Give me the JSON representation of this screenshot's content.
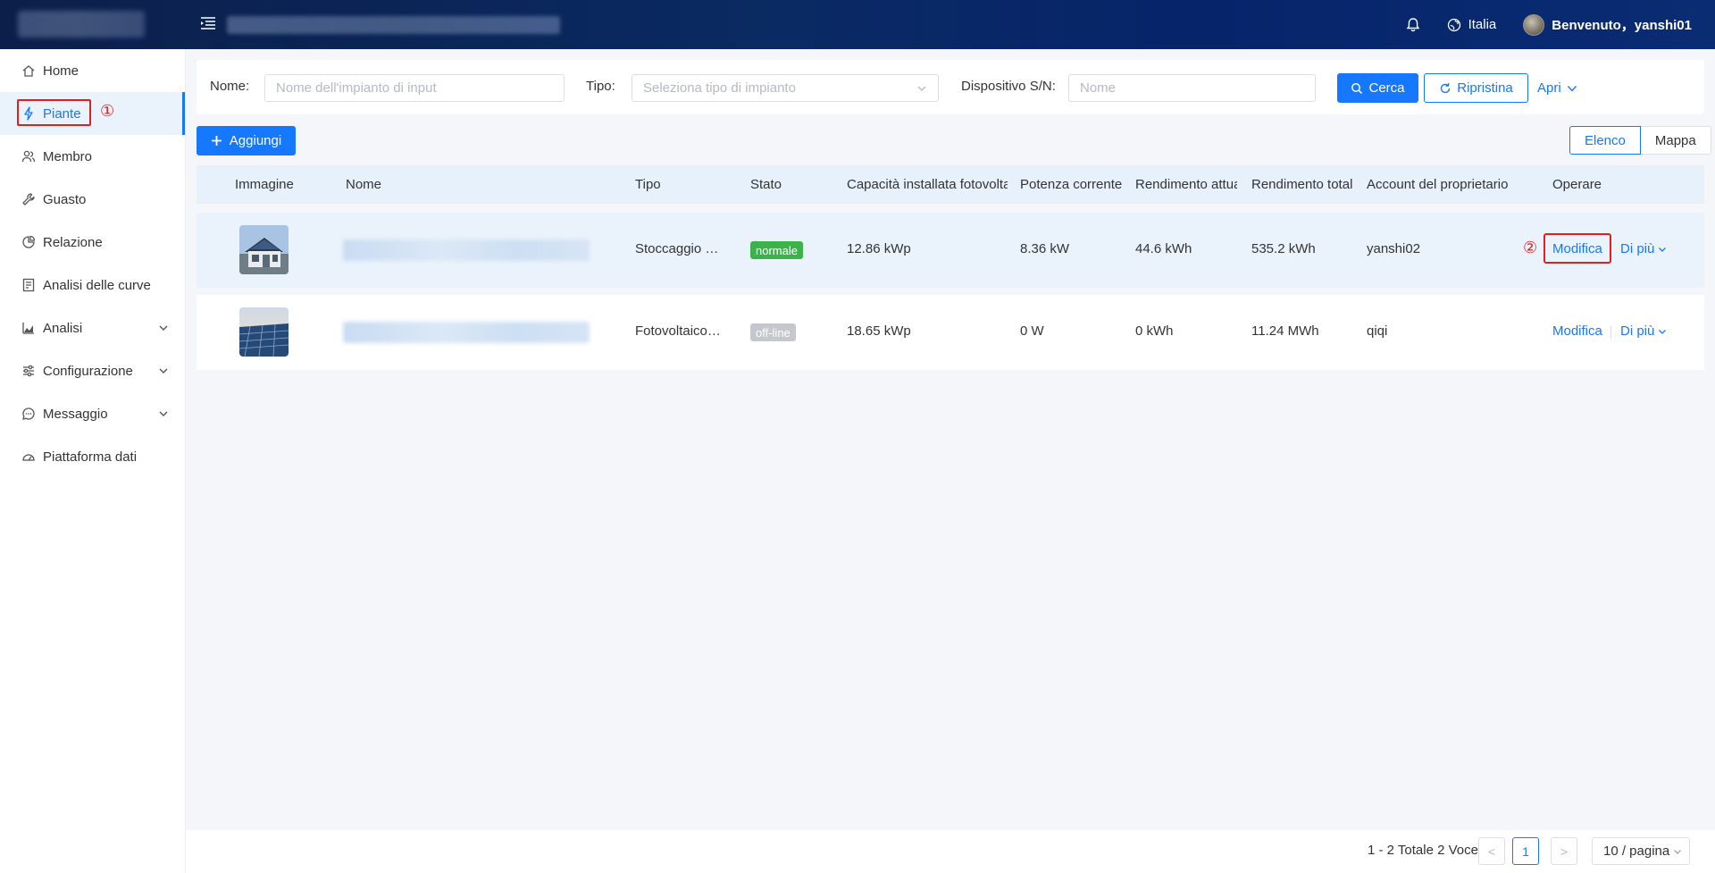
{
  "header": {
    "region": "Italia",
    "welcome": "Benvenuto，yanshi01"
  },
  "sidebar": {
    "items": [
      {
        "label": "Home",
        "icon": "home-icon"
      },
      {
        "label": "Piante",
        "icon": "plant-icon",
        "active": true
      },
      {
        "label": "Membro",
        "icon": "users-icon"
      },
      {
        "label": "Guasto",
        "icon": "wrench-icon"
      },
      {
        "label": "Relazione",
        "icon": "pie-chart-icon"
      },
      {
        "label": "Analisi delle curve",
        "icon": "report-icon"
      },
      {
        "label": "Analisi",
        "icon": "area-chart-icon",
        "expandable": true
      },
      {
        "label": "Configurazione",
        "icon": "sliders-icon",
        "expandable": true
      },
      {
        "label": "Messaggio",
        "icon": "message-icon",
        "expandable": true
      },
      {
        "label": "Piattaforma dati",
        "icon": "dashboard-icon"
      }
    ]
  },
  "annotations": {
    "step1": "①",
    "step2": "②"
  },
  "filters": {
    "name_label": "Nome:",
    "name_placeholder": "Nome dell'impianto di input",
    "type_label": "Tipo:",
    "type_placeholder": "Seleziona tipo di impianto",
    "sn_label": "Dispositivo S/N:",
    "sn_placeholder": "Nome",
    "search": "Cerca",
    "reset": "Ripristina",
    "expand": "Apri"
  },
  "toolbar": {
    "add": "Aggiungi",
    "view_list": "Elenco",
    "view_map": "Mappa"
  },
  "table": {
    "columns": [
      "Immagine",
      "Nome",
      "Tipo",
      "Stato",
      "Capacità installata fotovoltaica",
      "Potenza corrente",
      "Rendimento attuale",
      "Rendimento totale",
      "Account del proprietario",
      "Operare"
    ],
    "rows": [
      {
        "type": "Stoccaggio e…",
        "status": "normale",
        "capacity": "12.86 kWp",
        "power": "8.36 kW",
        "yield_now": "44.6 kWh",
        "yield_total": "535.2 kWh",
        "owner": "yanshi02",
        "edit": "Modifica",
        "more": "Di più"
      },
      {
        "type": "Fotovoltaico…",
        "status": "off-line",
        "capacity": "18.65 kWp",
        "power": "0 W",
        "yield_now": "0 kWh",
        "yield_total": "11.24 MWh",
        "owner": "qiqi",
        "edit": "Modifica",
        "more": "Di più"
      }
    ]
  },
  "pagination": {
    "summary": "1 - 2 Totale 2 Voce",
    "current": "1",
    "prev": "<",
    "next": ">",
    "page_size": "10 / pagina"
  },
  "colors": {
    "primary": "#1677ff",
    "success": "#3cb34a",
    "offline": "#c4c7cc",
    "annotation": "#e02020",
    "header_bg": "#0a2a63"
  }
}
